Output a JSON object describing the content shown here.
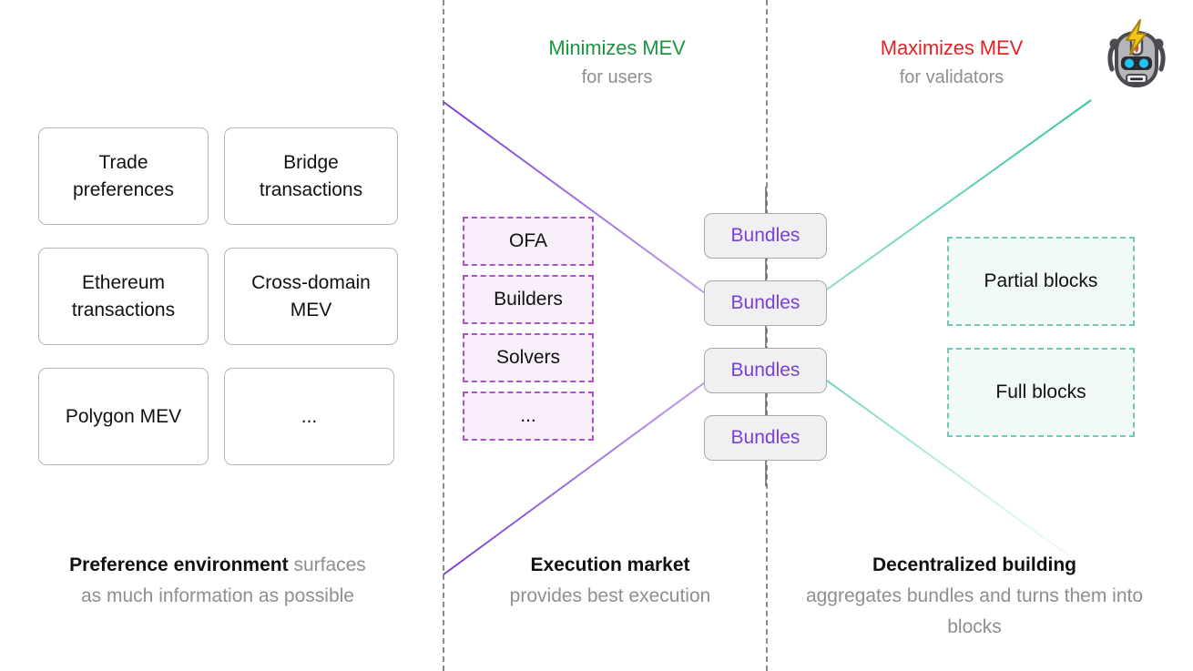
{
  "headers": [
    {
      "title": "Minimizes MEV",
      "subtitle": "for users",
      "color": "#1a9641"
    },
    {
      "title": "Maximizes MEV",
      "subtitle": "for validators",
      "color": "#e02424"
    }
  ],
  "robot": {
    "icon": "robot-face-icon",
    "emoji": "🤖"
  },
  "preference_cards": [
    {
      "label": "Trade preferences"
    },
    {
      "label": "Bridge transactions"
    },
    {
      "label": "Ethereum transactions"
    },
    {
      "label": "Cross-domain MEV"
    },
    {
      "label": "Polygon MEV"
    },
    {
      "label": "..."
    }
  ],
  "execution_market_cards": [
    {
      "label": "OFA"
    },
    {
      "label": "Builders"
    },
    {
      "label": "Solvers"
    },
    {
      "label": "..."
    }
  ],
  "bundles": [
    {
      "label": "Bundles"
    },
    {
      "label": "Bundles"
    },
    {
      "label": "Bundles"
    },
    {
      "label": "Bundles"
    }
  ],
  "block_cards": [
    {
      "label": "Partial blocks"
    },
    {
      "label": "Full blocks"
    }
  ],
  "captions": [
    {
      "strong": "Preference environment",
      "soft_inline": " surfaces",
      "soft_line": "as much information as possible"
    },
    {
      "strong": "Execution market",
      "soft_inline": "",
      "soft_line": "provides best execution"
    },
    {
      "strong": "Decentralized building",
      "soft_inline": "",
      "soft_line": "aggregates bundles and turns them into blocks"
    }
  ],
  "colors": {
    "accent_purple": "#7c3fd6",
    "dashed_purple": "#a855c9",
    "fill_purple": "#f8effa",
    "accent_teal": "#3bc9a8",
    "dashed_teal": "#6fc9b6",
    "fill_teal": "#f1faf7",
    "divider_gray": "#8a8a8a",
    "card_border": "#b7b7bb",
    "bundle_fill": "#f0f0f2",
    "text_dark": "#111113",
    "text_muted": "#8e8e93",
    "green": "#1a9641",
    "red": "#e02424"
  }
}
